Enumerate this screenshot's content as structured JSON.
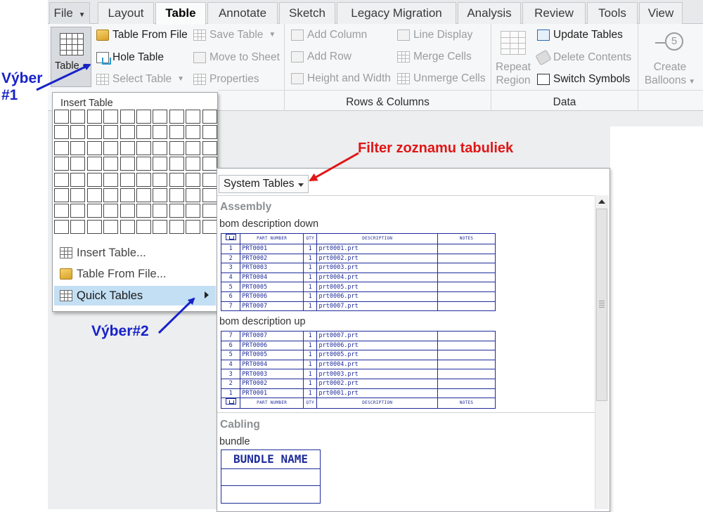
{
  "tabs": [
    "File",
    "Layout",
    "Table",
    "Annotate",
    "Sketch",
    "Legacy Migration",
    "Analysis",
    "Review",
    "Tools",
    "View"
  ],
  "active_tab": "Table",
  "ribbon": {
    "table_button": "Table",
    "table_from_file": "Table From File",
    "hole_table": "Hole Table",
    "select_table": "Select Table",
    "save_table": "Save Table",
    "move_to_sheet": "Move to Sheet",
    "properties": "Properties",
    "add_column": "Add Column",
    "add_row": "Add Row",
    "height_and_width": "Height and Width",
    "line_display": "Line Display",
    "merge_cells": "Merge Cells",
    "unmerge_cells": "Unmerge Cells",
    "repeat_region": [
      "Repeat",
      "Region"
    ],
    "update_tables": "Update Tables",
    "delete_contents": "Delete Contents",
    "switch_symbols": "Switch Symbols",
    "create_balloons": [
      "Create",
      "Balloons"
    ],
    "balloon_number": "5",
    "groups": {
      "rows_columns": "Rows & Columns",
      "data": "Data"
    }
  },
  "insert_menu": {
    "title": "Insert Table",
    "grid_columns": 10,
    "grid_rows": 8,
    "items": [
      "Insert Table...",
      "Table From File...",
      "Quick Tables"
    ],
    "highlighted": "Quick Tables"
  },
  "quick_tables": {
    "filter": "System Tables",
    "categories": {
      "assembly": "Assembly",
      "cabling": "Cabling"
    },
    "bom_down": {
      "name": "bom description down",
      "headers": [
        "PART NUMBER",
        "QTY",
        "DESCRIPTION",
        "NOTES"
      ],
      "rows": [
        [
          "1",
          "PRT0001",
          "1",
          "prt0001.prt"
        ],
        [
          "2",
          "PRT0002",
          "1",
          "prt0002.prt"
        ],
        [
          "3",
          "PRT0003",
          "1",
          "prt0003.prt"
        ],
        [
          "4",
          "PRT0004",
          "1",
          "prt0004.prt"
        ],
        [
          "5",
          "PRT0005",
          "1",
          "prt0005.prt"
        ],
        [
          "6",
          "PRT0006",
          "1",
          "prt0006.prt"
        ],
        [
          "7",
          "PRT0007",
          "1",
          "prt0007.prt"
        ]
      ]
    },
    "bom_up": {
      "name": "bom description up",
      "headers": [
        "PART NUMBER",
        "QTY",
        "DESCRIPTION",
        "NOTES"
      ],
      "rows": [
        [
          "7",
          "PRT0007",
          "1",
          "prt0007.prt"
        ],
        [
          "6",
          "PRT0006",
          "1",
          "prt0006.prt"
        ],
        [
          "5",
          "PRT0005",
          "1",
          "prt0005.prt"
        ],
        [
          "4",
          "PRT0004",
          "1",
          "prt0004.prt"
        ],
        [
          "3",
          "PRT0003",
          "1",
          "prt0003.prt"
        ],
        [
          "2",
          "PRT0002",
          "1",
          "prt0002.prt"
        ],
        [
          "1",
          "PRT0001",
          "1",
          "prt0001.prt"
        ]
      ]
    },
    "bundle": {
      "name": "bundle",
      "header": "BUNDLE NAME"
    }
  },
  "annotations": {
    "vyber1_line1": "Výber",
    "vyber1_line2": "#1",
    "vyber2": "Výber#2",
    "filter": "Filter zoznamu tabuliek"
  },
  "colors": {
    "annotation_blue": "#1722c8",
    "annotation_red": "#e01616",
    "menu_highlight": "#c3dff4",
    "table_ink": "#1f2c9a"
  }
}
